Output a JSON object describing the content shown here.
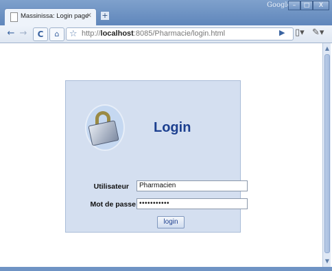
{
  "window": {
    "brand": "Google",
    "controls": {
      "minimize": "–",
      "maximize": "□",
      "close": "X"
    }
  },
  "tab": {
    "title": "Massinissa: Login page",
    "close": "×",
    "new_tab": "+"
  },
  "toolbar": {
    "back": "←",
    "forward": "→",
    "reload": "C",
    "home": "⌂",
    "star": "☆",
    "url_prefix": "http://",
    "url_host": "localhost",
    "url_rest": ":8085/Pharmacie/login.html",
    "go": "▶",
    "page_menu": "▯▾",
    "wrench": "✎▾"
  },
  "login": {
    "heading": "Login",
    "user_label": "Utilisateur",
    "user_value": "Pharmacien",
    "password_label": "Mot de passe",
    "password_value": "•••••••••••",
    "submit_label": "login"
  },
  "scrollbar": {
    "up": "▲",
    "down": "▼"
  }
}
